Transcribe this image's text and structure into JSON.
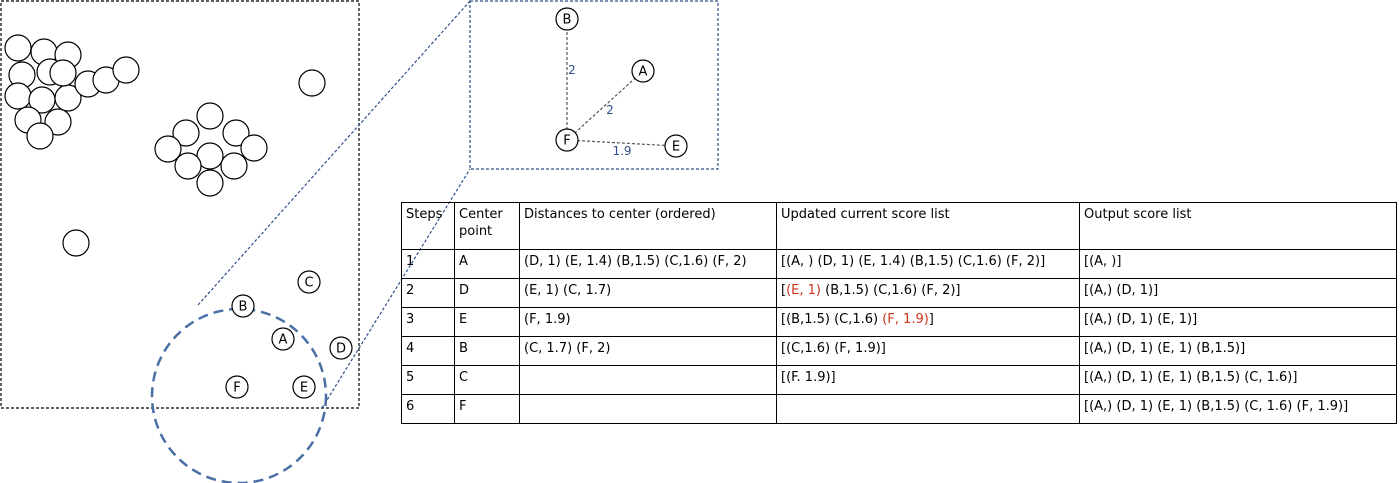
{
  "colors": {
    "edge": "#2f4f8a",
    "highlight": "#d0341b",
    "stroke": "#000000"
  },
  "left_scene": {
    "labeled_points": [
      "A",
      "B",
      "C",
      "D",
      "E",
      "F"
    ]
  },
  "zoom_view": {
    "nodes": [
      "A",
      "B",
      "E",
      "F"
    ],
    "edges": [
      {
        "from": "F",
        "to": "B",
        "label": "2"
      },
      {
        "from": "F",
        "to": "A",
        "label": "2"
      },
      {
        "from": "F",
        "to": "E",
        "label": "1.9"
      }
    ]
  },
  "table": {
    "headers": [
      "Steps",
      "Center point",
      "Distances to center (ordered)",
      "Updated current score list",
      "Output score list"
    ],
    "rows": [
      {
        "step": "1",
        "center": "A",
        "distances": "(D, 1) (E, 1.4) (B,1.5) (C,1.6) (F, 2)",
        "updated": [
          {
            "t": "[(A, ) (D, 1) (E, 1.4) (B,1.5) (C,1.6) (F, 2)]"
          }
        ],
        "output": "[(A, )]"
      },
      {
        "step": "2",
        "center": "D",
        "distances": "(E, 1) (C, 1.7)",
        "updated": [
          {
            "t": "["
          },
          {
            "t": "(E, 1)",
            "red": true
          },
          {
            "t": " (B,1.5) (C,1.6) (F, 2)]"
          }
        ],
        "output": "[(A,) (D, 1)]"
      },
      {
        "step": "3",
        "center": "E",
        "distances": "(F, 1.9)",
        "updated": [
          {
            "t": "[(B,1.5) (C,1.6) "
          },
          {
            "t": "(F, 1.9)",
            "red": true
          },
          {
            "t": "]"
          }
        ],
        "output": "[(A,) (D, 1) (E, 1)]"
      },
      {
        "step": "4",
        "center": "B",
        "distances": "(C, 1.7) (F, 2)",
        "updated": [
          {
            "t": "[(C,1.6) (F, 1.9)]"
          }
        ],
        "output": "[(A,) (D, 1) (E, 1) (B,1.5)]"
      },
      {
        "step": "5",
        "center": "C",
        "distances": "",
        "updated": [
          {
            "t": "[(F. 1.9)]"
          }
        ],
        "output": "[(A,) (D, 1) (E, 1) (B,1.5) (C, 1.6)]"
      },
      {
        "step": "6",
        "center": "F",
        "distances": "",
        "updated": [],
        "output": "[(A,) (D, 1) (E, 1) (B,1.5) (C, 1.6) (F, 1.9)]"
      }
    ]
  }
}
